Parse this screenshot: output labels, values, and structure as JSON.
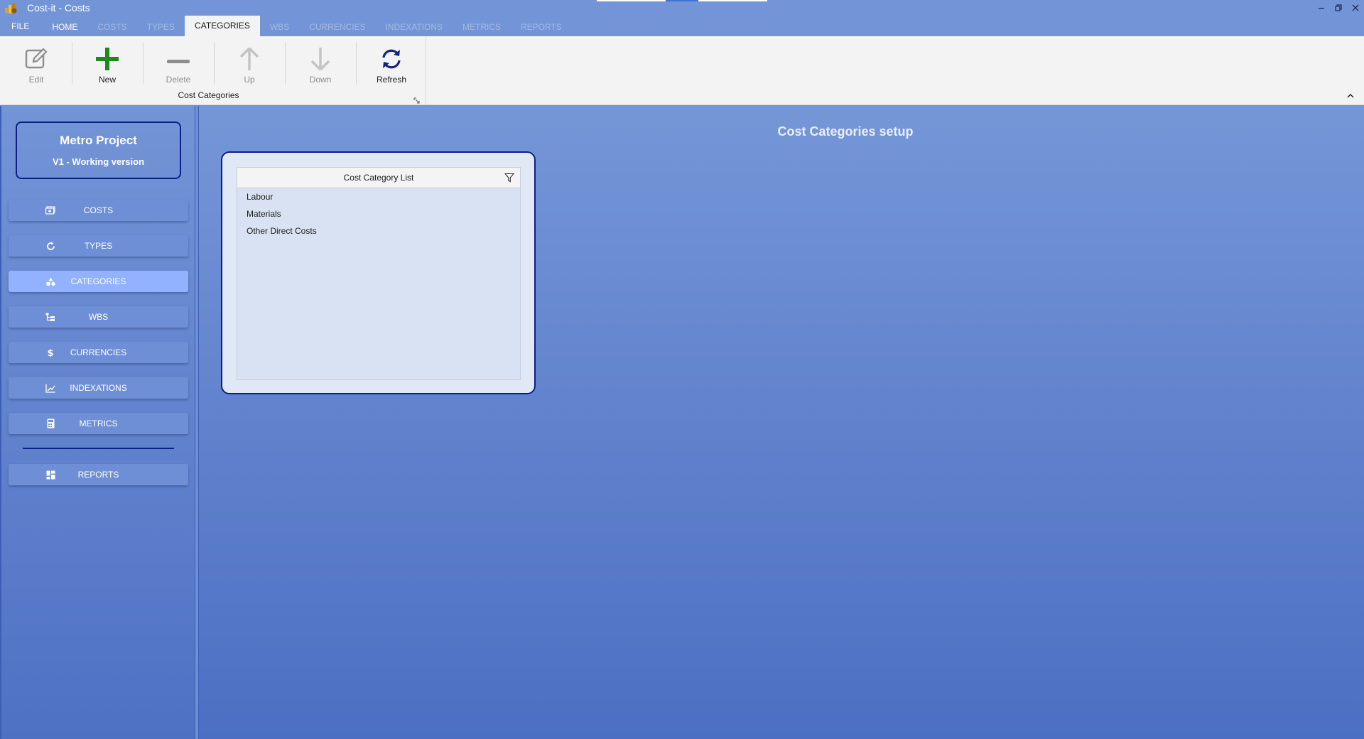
{
  "window": {
    "title": "Cost-it - Costs"
  },
  "tabs": [
    {
      "label": "FILE",
      "state": "normal"
    },
    {
      "label": "HOME",
      "state": "normal"
    },
    {
      "label": "COSTS",
      "state": "disabled"
    },
    {
      "label": "TYPES",
      "state": "disabled"
    },
    {
      "label": "CATEGORIES",
      "state": "active"
    },
    {
      "label": "WBS",
      "state": "disabled"
    },
    {
      "label": "CURRENCIES",
      "state": "disabled"
    },
    {
      "label": "INDEXATIONS",
      "state": "disabled"
    },
    {
      "label": "METRICS",
      "state": "disabled"
    },
    {
      "label": "REPORTS",
      "state": "disabled"
    }
  ],
  "ribbon": {
    "group_label": "Cost Categories",
    "buttons": {
      "edit": "Edit",
      "new": "New",
      "delete": "Delete",
      "up": "Up",
      "down": "Down",
      "refresh": "Refresh"
    }
  },
  "sidebar": {
    "project_name": "Metro Project",
    "project_version": "V1 - Working version",
    "items": [
      {
        "label": "COSTS",
        "icon": "money-icon"
      },
      {
        "label": "TYPES",
        "icon": "circle-refresh-icon"
      },
      {
        "label": "CATEGORIES",
        "icon": "shapes-icon"
      },
      {
        "label": "WBS",
        "icon": "tree-structure-icon"
      },
      {
        "label": "CURRENCIES",
        "icon": "dollar-icon"
      },
      {
        "label": "INDEXATIONS",
        "icon": "line-chart-icon"
      },
      {
        "label": "METRICS",
        "icon": "calculator-icon"
      },
      {
        "label": "REPORTS",
        "icon": "dashboard-icon"
      }
    ],
    "active_item": "CATEGORIES"
  },
  "main": {
    "title": "Cost Categories setup",
    "list": {
      "header": "Cost Category List",
      "rows": [
        "Labour",
        "Materials",
        "Other Direct Costs"
      ]
    }
  },
  "colors": {
    "accent_dark": "#0c1f8a",
    "nav_active": "#92b1ff",
    "new_green": "#1e8a1e",
    "refresh_blue": "#12247a"
  }
}
